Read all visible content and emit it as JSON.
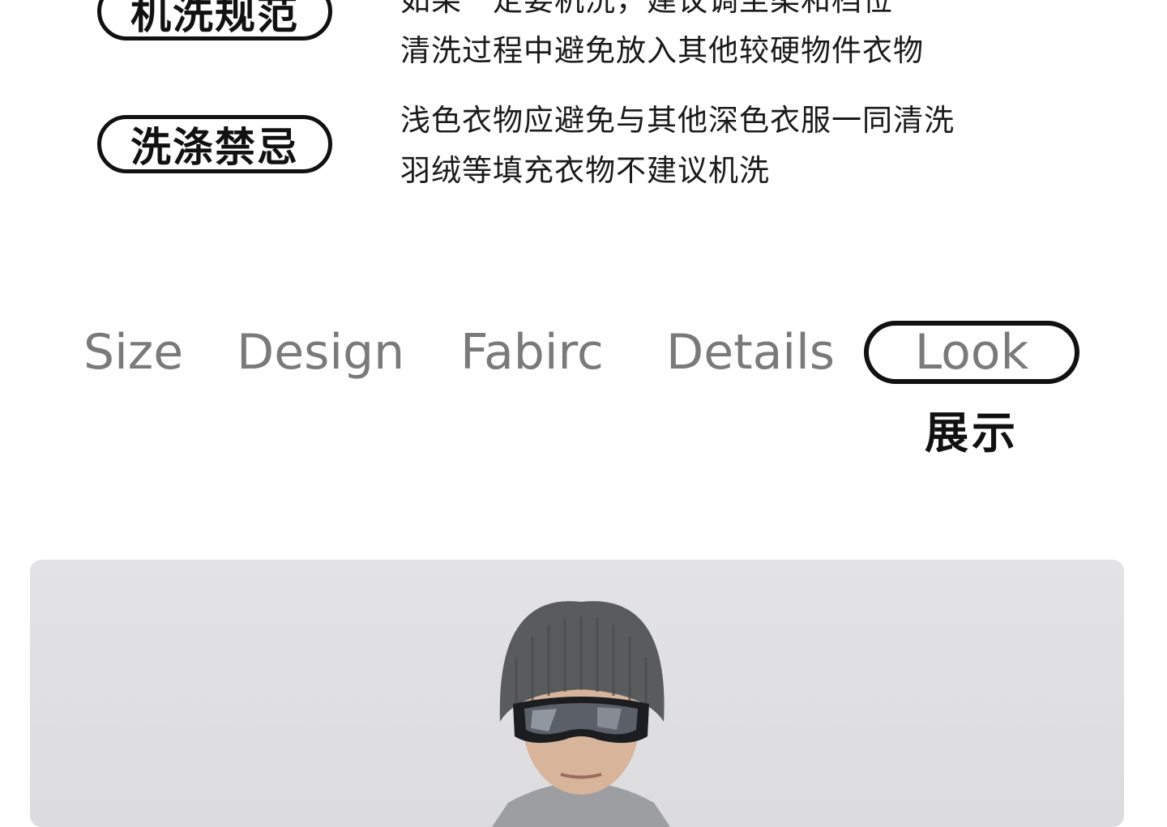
{
  "wash": {
    "rows": [
      {
        "label": "机洗规范",
        "lines": [
          "如果一定要机洗，建议调至柔和档位",
          "清洗过程中避免放入其他较硬物件衣物"
        ]
      },
      {
        "label": "洗涤禁忌",
        "lines": [
          "浅色衣物应避免与其他深色衣服一同清洗",
          "羽绒等填充衣物不建议机洗"
        ]
      }
    ]
  },
  "tabs": {
    "items": [
      "Size",
      "Design",
      "Fabirc",
      "Details",
      "Look"
    ],
    "active_index": 4,
    "active_sublabel": "展示"
  },
  "colors": {
    "text": "#1a1a1a",
    "tab_inactive": "#7a7a7a",
    "photo_bg": "#dfdfe1",
    "beanie": "#5a5b5d"
  }
}
